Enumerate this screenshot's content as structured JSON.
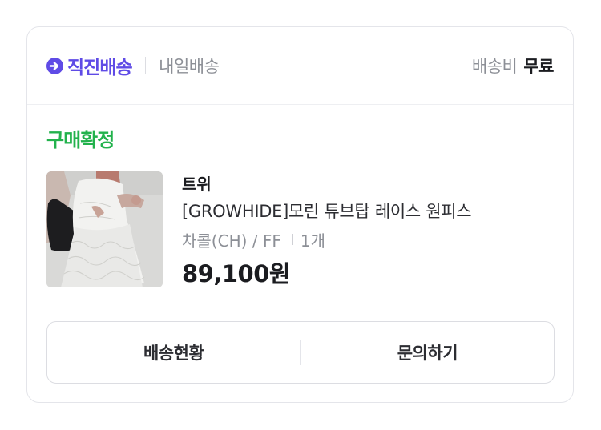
{
  "shipping": {
    "direct_label": "직진배송",
    "tomorrow_label": "내일배송",
    "fee_label": "배송비",
    "fee_value": "무료",
    "accent_color": "#5f4be6"
  },
  "order": {
    "status": "구매확정",
    "status_color": "#22b24c",
    "brand": "트위",
    "product_name": "[GROWHIDE]모린 튜브탑 레이스 원피스",
    "option": "차콜(CH) / FF",
    "quantity": "1개",
    "price": "89,100원"
  },
  "actions": {
    "track_label": "배송현황",
    "inquiry_label": "문의하기"
  }
}
